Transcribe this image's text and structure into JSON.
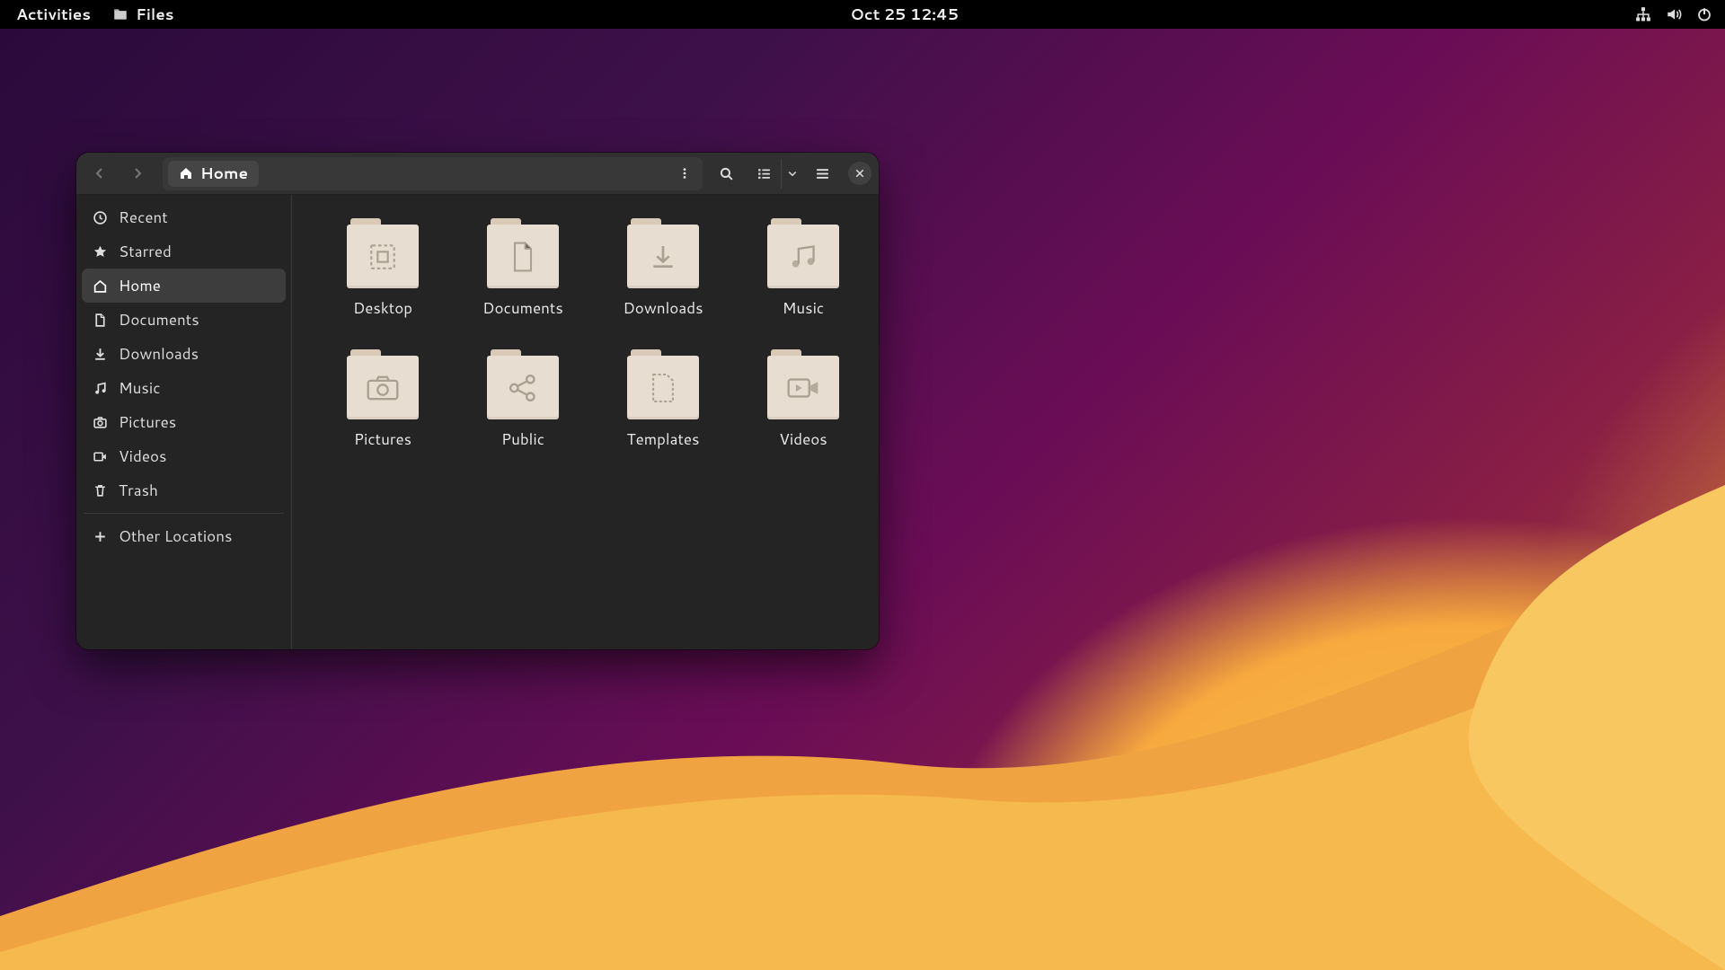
{
  "panel": {
    "activities": "Activities",
    "app_name": "Files",
    "clock": "Oct 25  12:45"
  },
  "window": {
    "path_label": "Home",
    "sidebar": {
      "items": [
        {
          "id": "recent",
          "label": "Recent"
        },
        {
          "id": "starred",
          "label": "Starred"
        },
        {
          "id": "home",
          "label": "Home"
        },
        {
          "id": "documents",
          "label": "Documents"
        },
        {
          "id": "downloads",
          "label": "Downloads"
        },
        {
          "id": "music",
          "label": "Music"
        },
        {
          "id": "pictures",
          "label": "Pictures"
        },
        {
          "id": "videos",
          "label": "Videos"
        },
        {
          "id": "trash",
          "label": "Trash"
        }
      ],
      "other_locations": "Other Locations",
      "active_id": "home"
    },
    "folders": [
      {
        "id": "desktop",
        "label": "Desktop"
      },
      {
        "id": "documents",
        "label": "Documents"
      },
      {
        "id": "downloads",
        "label": "Downloads"
      },
      {
        "id": "music",
        "label": "Music"
      },
      {
        "id": "pictures",
        "label": "Pictures"
      },
      {
        "id": "public",
        "label": "Public"
      },
      {
        "id": "templates",
        "label": "Templates"
      },
      {
        "id": "videos",
        "label": "Videos"
      }
    ]
  }
}
